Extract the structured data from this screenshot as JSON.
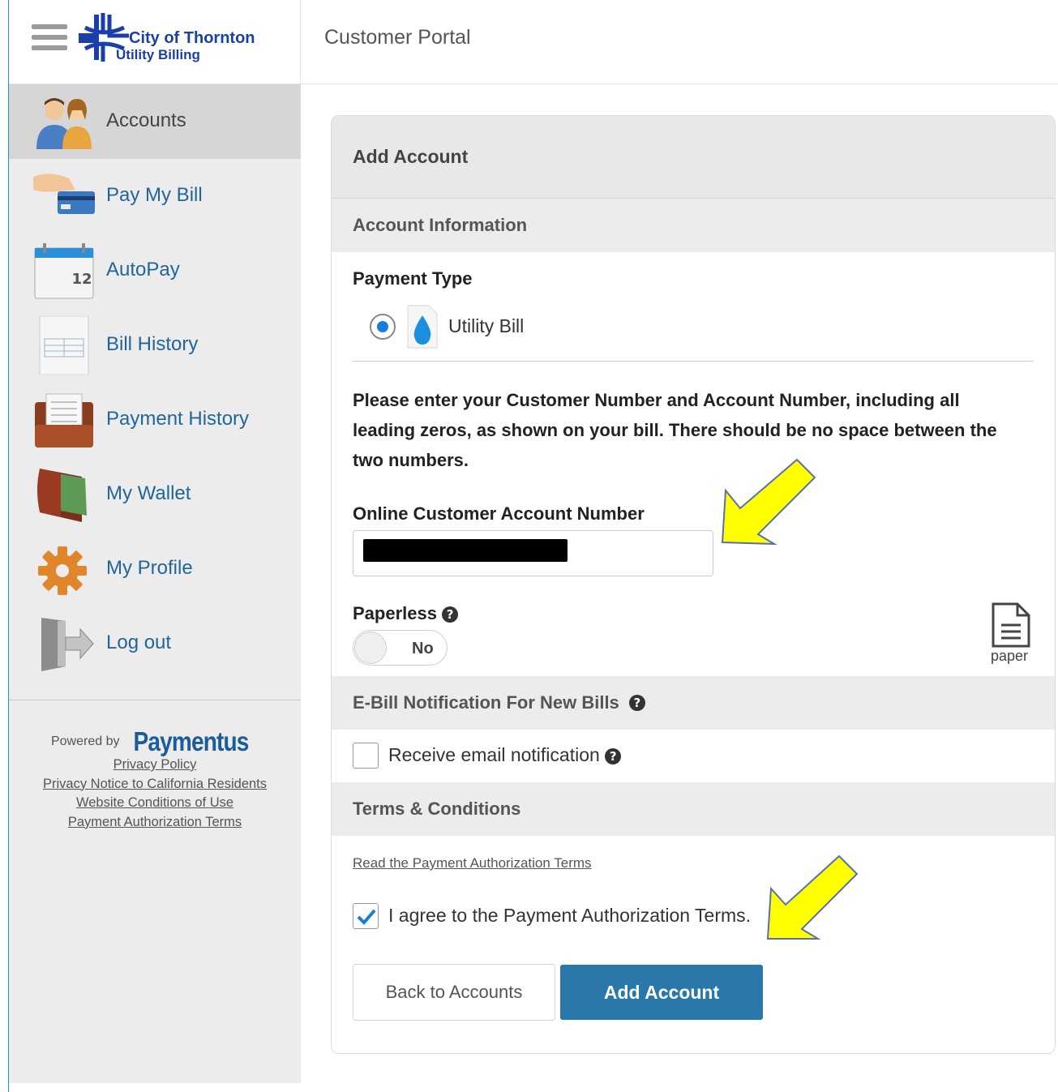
{
  "header": {
    "logo_line1": "City of Thornton",
    "logo_line2": "Utility Billing",
    "portal_title": "Customer Portal"
  },
  "sidebar": {
    "items": [
      {
        "label": "Accounts",
        "icon": "users-icon"
      },
      {
        "label": "Pay My Bill",
        "icon": "card-payment-icon"
      },
      {
        "label": "AutoPay",
        "icon": "calendar-icon"
      },
      {
        "label": "Bill History",
        "icon": "invoice-icon"
      },
      {
        "label": "Payment History",
        "icon": "receipts-icon"
      },
      {
        "label": "My Wallet",
        "icon": "wallet-icon"
      },
      {
        "label": "My Profile",
        "icon": "gear-icon"
      },
      {
        "label": "Log out",
        "icon": "logout-door-icon"
      }
    ],
    "powered_by": "Powered by",
    "powered_brand": "Paymentus",
    "footer_links": [
      "Privacy Policy",
      "Privacy Notice to California Residents",
      "Website Conditions of Use",
      "Payment Authorization Terms"
    ]
  },
  "form": {
    "title": "Add Account",
    "account_info_heading": "Account Information",
    "payment_type_label": "Payment Type",
    "payment_type_option": "Utility Bill",
    "instructions": "Please enter your Customer Number and Account Number, including all leading zeros, as shown on your bill. There should be no space between the two numbers.",
    "account_number_label": "Online Customer Account Number",
    "paperless_label": "Paperless",
    "paperless_value": "No",
    "paper_label": "paper",
    "ebill_heading": "E-Bill Notification For New Bills",
    "email_notification_label": "Receive email notification",
    "email_notification_checked": false,
    "terms_heading": "Terms & Conditions",
    "terms_link": "Read the Payment Authorization Terms",
    "agree_label": "I agree to the Payment Authorization Terms.",
    "agree_checked": true,
    "back_button": "Back to Accounts",
    "add_button": "Add Account"
  },
  "colors": {
    "primary_button": "#2a78aa",
    "nav_link": "#21669a",
    "annotation_arrow": "#ffff00"
  }
}
